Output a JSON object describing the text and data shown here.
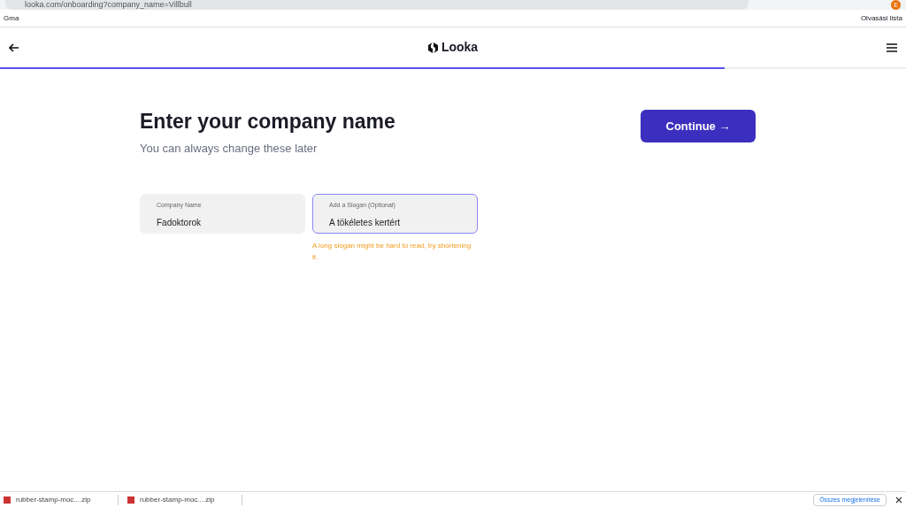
{
  "browser": {
    "address": "looka.com/onboarding?company_name=Villbull",
    "bookmarks": [
      "Gma"
    ],
    "reading_list": "Olvasási lista",
    "profile_initial": "E"
  },
  "header": {
    "logo": "Looka",
    "progress": {
      "level": 0.8
    }
  },
  "page": {
    "title": "Enter your company name",
    "subtitle": "You can always change these later",
    "continue_button": "Continue →",
    "fields": [
      {
        "label": "Company Name",
        "value": "Fadoktorok",
        "focused": false
      },
      {
        "label": "Add a Slogan (Optional)",
        "value": "A tökéletes kertért",
        "focused": true,
        "warning": "A long slogan might be hard to read, try shortening it."
      }
    ]
  },
  "downloads": {
    "items": [
      "rubber-stamp-moc....zip",
      "rubber-stamp-moc....zip"
    ],
    "show_all": "Összes megjelenítése"
  }
}
